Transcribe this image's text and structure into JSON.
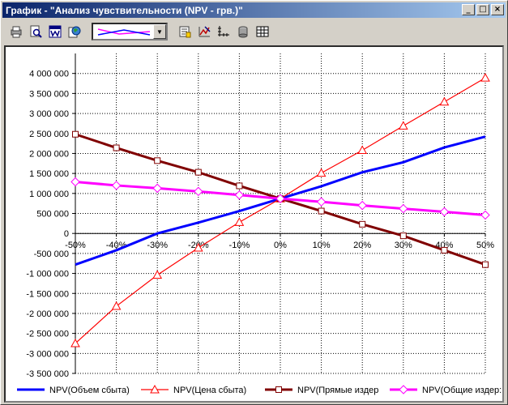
{
  "window": {
    "title": "График - \"Анализ чувствительности (NPV - грв.)\"",
    "buttons": {
      "minimize": "_",
      "maximize": "□",
      "close": "×"
    }
  },
  "toolbar": {
    "icons": [
      "print-icon",
      "print-preview-icon",
      "word-export-icon",
      "globe-icon",
      "chart-type-combo",
      "properties-icon",
      "chart-style-icon",
      "axes-icon",
      "3d-icon",
      "table-icon"
    ]
  },
  "colors": {
    "series1": "#0000ff",
    "series2": "#ff0000",
    "series3": "#800000",
    "series4": "#ff00ff"
  },
  "chart_data": {
    "type": "line",
    "title": "",
    "xlabel": "",
    "ylabel": "",
    "categories": [
      "-50%",
      "-40%",
      "-30%",
      "-20%",
      "-10%",
      "0%",
      "10%",
      "20%",
      "30%",
      "40%",
      "50%"
    ],
    "ylim": [
      -3500000,
      4500000
    ],
    "ytick_step": 500000,
    "ytick_labels": [
      "-3 500 000",
      "-3 000 000",
      "-2 500 000",
      "-2 000 000",
      "-1 500 000",
      "-1 000 000",
      "-500 000",
      "0",
      "500 000",
      "1 000 000",
      "1 500 000",
      "2 000 000",
      "2 500 000",
      "3 000 000",
      "3 500 000",
      "4 000 000"
    ],
    "grid": true,
    "legend_position": "bottom",
    "series": [
      {
        "name": "NPV(Объем сбыта)",
        "marker": "none",
        "values": [
          -780000,
          -420000,
          0,
          270000,
          560000,
          870000,
          1180000,
          1530000,
          1780000,
          2150000,
          2420000
        ]
      },
      {
        "name": "NPV(Цена сбыта)",
        "marker": "triangle",
        "values": [
          -2750000,
          -1820000,
          -1040000,
          -360000,
          280000,
          870000,
          1510000,
          2080000,
          2690000,
          3290000,
          3890000
        ]
      },
      {
        "name": "NPV(Прямые издер",
        "marker": "square",
        "values": [
          2480000,
          2140000,
          1820000,
          1530000,
          1190000,
          870000,
          560000,
          230000,
          -60000,
          -420000,
          -780000
        ]
      },
      {
        "name": "NPV(Общие издер:",
        "marker": "diamond",
        "values": [
          1290000,
          1200000,
          1130000,
          1050000,
          960000,
          870000,
          790000,
          700000,
          620000,
          540000,
          460000
        ]
      }
    ]
  }
}
